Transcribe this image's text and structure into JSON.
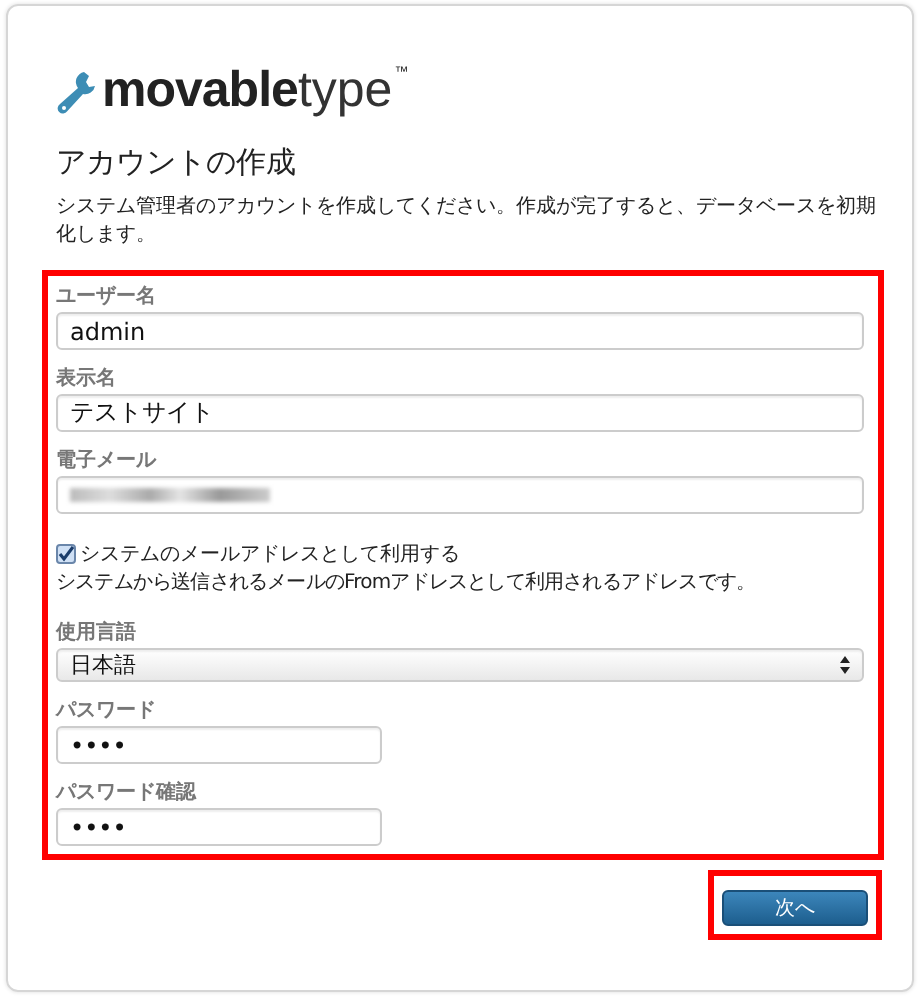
{
  "logo": {
    "bold": "movable",
    "light": "type",
    "mark": "™"
  },
  "heading": "アカウントの作成",
  "description": "システム管理者のアカウントを作成してください。作成が完了すると、データベースを初期化します。",
  "form": {
    "highlighted": true,
    "fields": [
      {
        "kind": "text",
        "label": "ユーザー名",
        "value": "admin"
      },
      {
        "kind": "text",
        "label": "表示名",
        "value": "テストサイト"
      },
      {
        "kind": "blurred",
        "label": "電子メール"
      },
      {
        "kind": "checkbox",
        "label": "システムのメールアドレスとして利用する",
        "checked": true,
        "hint": "システムから送信されるメールのFromアドレスとして利用されるアドレスです。"
      },
      {
        "kind": "select",
        "label": "使用言語",
        "value": "日本語"
      },
      {
        "kind": "password",
        "label": "パスワード",
        "value": "••••"
      },
      {
        "kind": "password",
        "label": "パスワード確認",
        "value": "••••"
      }
    ]
  },
  "next_button": {
    "label": "次へ",
    "highlighted": true
  }
}
